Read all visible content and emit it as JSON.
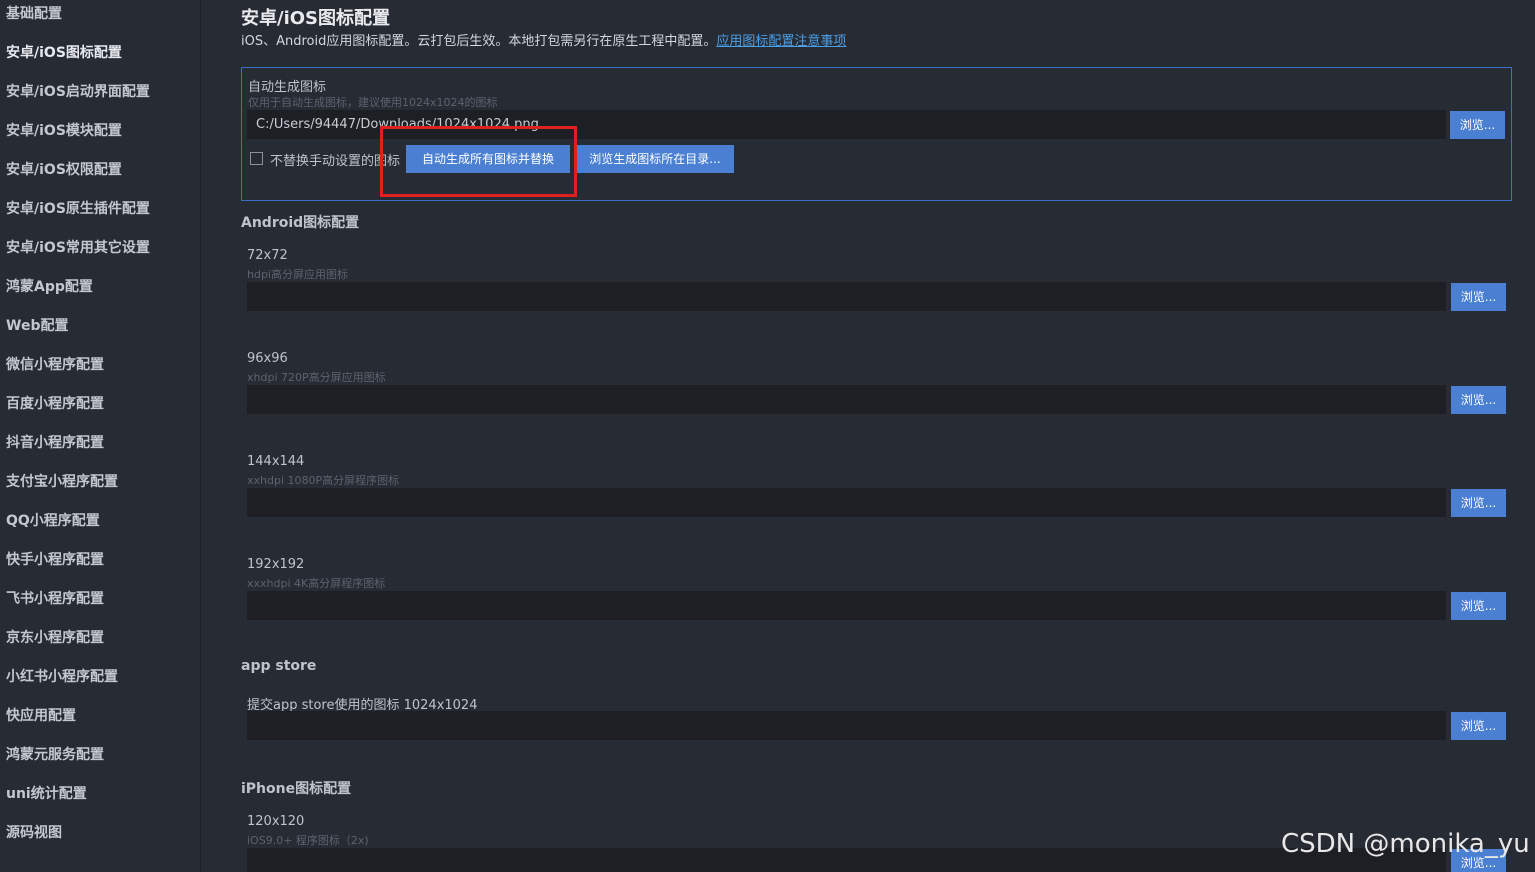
{
  "sidebar": {
    "items": [
      {
        "label": "基础配置"
      },
      {
        "label": "安卓/iOS图标配置"
      },
      {
        "label": "安卓/iOS启动界面配置"
      },
      {
        "label": "安卓/iOS模块配置"
      },
      {
        "label": "安卓/iOS权限配置"
      },
      {
        "label": "安卓/iOS原生插件配置"
      },
      {
        "label": "安卓/iOS常用其它设置"
      },
      {
        "label": "鸿蒙App配置"
      },
      {
        "label": "Web配置"
      },
      {
        "label": "微信小程序配置"
      },
      {
        "label": "百度小程序配置"
      },
      {
        "label": "抖音小程序配置"
      },
      {
        "label": "支付宝小程序配置"
      },
      {
        "label": "QQ小程序配置"
      },
      {
        "label": "快手小程序配置"
      },
      {
        "label": "飞书小程序配置"
      },
      {
        "label": "京东小程序配置"
      },
      {
        "label": "小红书小程序配置"
      },
      {
        "label": "快应用配置"
      },
      {
        "label": "鸿蒙元服务配置"
      },
      {
        "label": "uni统计配置"
      },
      {
        "label": "源码视图"
      }
    ]
  },
  "page": {
    "title": "安卓/iOS图标配置",
    "description": "iOS、Android应用图标配置。云打包后生效。本地打包需另行在原生工程中配置。",
    "link": "应用图标配置注意事项"
  },
  "auto_generate": {
    "label": "自动生成图标",
    "hint": "仅用于自动生成图标，建议使用1024x1024的图标",
    "path_value": "C:/Users/94447/Downloads/1024x1024.png",
    "browse_label": "浏览...",
    "checkbox_label": "不替换手动设置的图标",
    "generate_button": "自动生成所有图标并替换",
    "browse_dir_button": "浏览生成图标所在目录..."
  },
  "android": {
    "section_title": "Android图标配置",
    "fields": [
      {
        "label": "72x72",
        "hint": "hdpi高分屏应用图标",
        "value": "",
        "browse": "浏览..."
      },
      {
        "label": "96x96",
        "hint": "xhdpi 720P高分屏应用图标",
        "value": "",
        "browse": "浏览..."
      },
      {
        "label": "144x144",
        "hint": "xxhdpi 1080P高分屏程序图标",
        "value": "",
        "browse": "浏览..."
      },
      {
        "label": "192x192",
        "hint": "xxxhdpi 4K高分屏程序图标",
        "value": "",
        "browse": "浏览..."
      }
    ]
  },
  "appstore": {
    "section_title": "app store",
    "field_label": "提交app store使用的图标 1024x1024",
    "value": "",
    "browse": "浏览..."
  },
  "iphone": {
    "section_title": "iPhone图标配置",
    "field_label": "120x120",
    "field_hint": "iOS9.0+ 程序图标（2x)",
    "value": "",
    "browse": "浏览..."
  },
  "watermark": "CSDN @monika_yu",
  "colors": {
    "background": "#272b34",
    "input_bg": "#1d1f24",
    "button": "#4a7fd1",
    "box_border": "#3a6fc4",
    "highlight": "#e01f1f",
    "link": "#4a9fe8"
  }
}
